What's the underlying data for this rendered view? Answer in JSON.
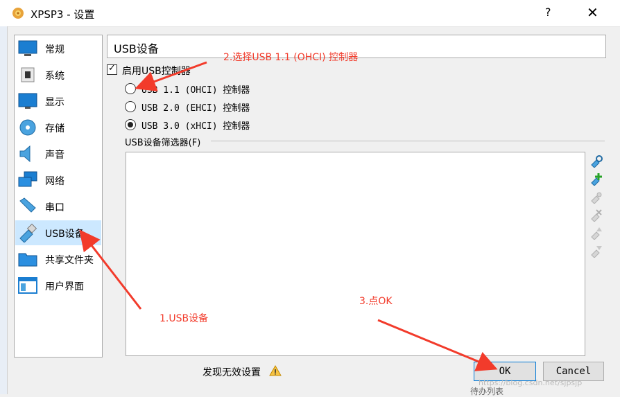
{
  "window": {
    "title": "XPSP3 - 设置",
    "help_label": "?",
    "close_label": "✕"
  },
  "sidebar": {
    "items": [
      {
        "label": "常规",
        "icon": "general-icon"
      },
      {
        "label": "系统",
        "icon": "system-icon"
      },
      {
        "label": "显示",
        "icon": "display-icon"
      },
      {
        "label": "存储",
        "icon": "storage-icon"
      },
      {
        "label": "声音",
        "icon": "audio-icon"
      },
      {
        "label": "网络",
        "icon": "network-icon"
      },
      {
        "label": "串口",
        "icon": "serial-port-icon"
      },
      {
        "label": "USB设备",
        "icon": "usb-icon",
        "selected": true
      },
      {
        "label": "共享文件夹",
        "icon": "shared-folder-icon"
      },
      {
        "label": "用户界面",
        "icon": "user-interface-icon"
      }
    ]
  },
  "main": {
    "header": "USB设备",
    "enable_usb_label": "启用USB控制器",
    "enable_usb_checked": true,
    "controllers": [
      {
        "label": "USB 1.1 (OHCI) 控制器",
        "selected": false
      },
      {
        "label": "USB 2.0 (EHCI) 控制器",
        "selected": false
      },
      {
        "label": "USB 3.0 (xHCI) 控制器",
        "selected": true
      }
    ],
    "filter_label": "USB设备筛选器(F)"
  },
  "footer": {
    "invalid_settings_label": "发现无效设置",
    "ok_label": "OK",
    "cancel_label": "Cancel"
  },
  "annotations": {
    "step1": "1.USB设备",
    "step2": "2.选择USB 1.1 (OHCI) 控制器",
    "step3": "3.点OK",
    "color": "#f23b2b"
  },
  "watermark": "https://blog.csdn.net/sjpsjp",
  "background_fragment": "待办列表"
}
